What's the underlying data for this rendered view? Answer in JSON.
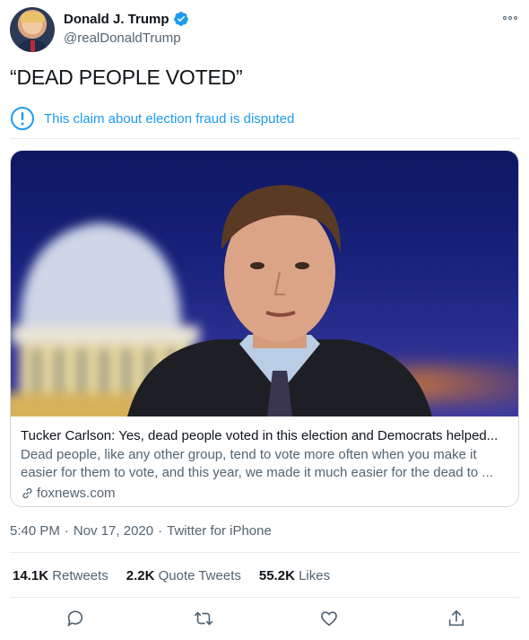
{
  "author": {
    "display_name": "Donald J. Trump",
    "handle": "@realDonaldTrump",
    "verified": true
  },
  "tweet": {
    "text": "“DEAD PEOPLE VOTED”"
  },
  "notice": {
    "icon": "info-circle-icon",
    "text": "This claim about election fraud is disputed"
  },
  "card": {
    "title": "Tucker Carlson: Yes, dead people voted in this election and Democrats helped...",
    "description": "Dead people, like any other group, tend to vote more often when you make it easier for them to vote, and this year, we made it much easier for the dead to ...",
    "domain": "foxnews.com"
  },
  "meta": {
    "time": "5:40 PM",
    "separator": "·",
    "date": "Nov 17, 2020",
    "source": "Twitter for iPhone"
  },
  "stats": {
    "retweets_count": "14.1K",
    "retweets_label": "Retweets",
    "quotes_count": "2.2K",
    "quotes_label": "Quote Tweets",
    "likes_count": "55.2K",
    "likes_label": "Likes"
  },
  "actions": [
    "reply-icon",
    "retweet-icon",
    "like-icon",
    "share-icon"
  ],
  "colors": {
    "accent": "#1d9bf0",
    "text_primary": "#0f1419",
    "text_secondary": "#536471",
    "border": "#cfd9de"
  }
}
